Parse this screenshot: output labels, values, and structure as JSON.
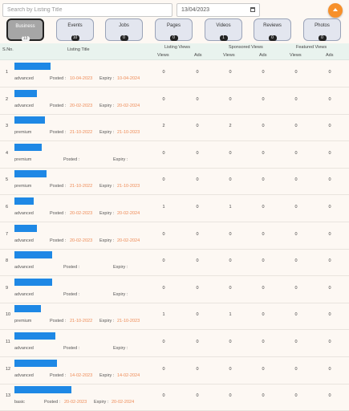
{
  "search": {
    "placeholder": "Search by Listing Title",
    "value": ""
  },
  "date_filter": {
    "value": "13/04/2023"
  },
  "fab": {
    "icon": "chevron-up-icon",
    "color": "#f7902a"
  },
  "tabs": [
    {
      "label": "Business",
      "count": "13",
      "active": true
    },
    {
      "label": "Events",
      "count": "10",
      "active": false
    },
    {
      "label": "Jobs",
      "count": "0",
      "active": false
    },
    {
      "label": "Pages",
      "count": "0",
      "active": false
    },
    {
      "label": "Videos",
      "count": "1",
      "active": false
    },
    {
      "label": "Reviews",
      "count": "0",
      "active": false
    },
    {
      "label": "Photos",
      "count": "0",
      "active": false
    }
  ],
  "table": {
    "headers": {
      "sno": "S.No.",
      "title": "Listing Title",
      "listing_views": "Listing Views",
      "sponsored_views": "Sponsored Views",
      "featured_views": "Featured Views",
      "views": "Views",
      "ads": "Ads"
    },
    "posted_label": "Posted :",
    "expiry_label": "Expiry :",
    "title_bar_color": "#1e88e5",
    "rows": [
      {
        "sno": "1",
        "type": "advanced",
        "posted": "10-04-2023",
        "expiry": "10-04-2024",
        "lv": "0",
        "la": "0",
        "sv": "0",
        "sa": "0",
        "fv": "0",
        "fa": "0"
      },
      {
        "sno": "2",
        "type": "advanced",
        "posted": "20-02-2023",
        "expiry": "20-02-2024",
        "lv": "0",
        "la": "0",
        "sv": "0",
        "sa": "0",
        "fv": "0",
        "fa": "0"
      },
      {
        "sno": "3",
        "type": "premium",
        "posted": "21-10-2022",
        "expiry": "21-10-2023",
        "lv": "2",
        "la": "0",
        "sv": "2",
        "sa": "0",
        "fv": "0",
        "fa": "0"
      },
      {
        "sno": "4",
        "type": "premium",
        "posted": "",
        "expiry": "",
        "lv": "0",
        "la": "0",
        "sv": "0",
        "sa": "0",
        "fv": "0",
        "fa": "0"
      },
      {
        "sno": "5",
        "type": "premium",
        "posted": "21-10-2022",
        "expiry": "21-10-2023",
        "lv": "0",
        "la": "0",
        "sv": "0",
        "sa": "0",
        "fv": "0",
        "fa": "0"
      },
      {
        "sno": "6",
        "type": "advanced",
        "posted": "20-02-2023",
        "expiry": "20-02-2024",
        "lv": "1",
        "la": "0",
        "sv": "1",
        "sa": "0",
        "fv": "0",
        "fa": "0"
      },
      {
        "sno": "7",
        "type": "advanced",
        "posted": "20-02-2023",
        "expiry": "20-02-2024",
        "lv": "0",
        "la": "0",
        "sv": "0",
        "sa": "0",
        "fv": "0",
        "fa": "0"
      },
      {
        "sno": "8",
        "type": "advanced",
        "posted": "",
        "expiry": "",
        "lv": "0",
        "la": "0",
        "sv": "0",
        "sa": "0",
        "fv": "0",
        "fa": "0"
      },
      {
        "sno": "9",
        "type": "advanced",
        "posted": "",
        "expiry": "",
        "lv": "0",
        "la": "0",
        "sv": "0",
        "sa": "0",
        "fv": "0",
        "fa": "0"
      },
      {
        "sno": "10",
        "type": "premium",
        "posted": "21-10-2022",
        "expiry": "21-10-2023",
        "lv": "1",
        "la": "0",
        "sv": "1",
        "sa": "0",
        "fv": "0",
        "fa": "0"
      },
      {
        "sno": "11",
        "type": "advanced",
        "posted": "",
        "expiry": "",
        "lv": "0",
        "la": "0",
        "sv": "0",
        "sa": "0",
        "fv": "0",
        "fa": "0"
      },
      {
        "sno": "12",
        "type": "advanced",
        "posted": "14-02-2023",
        "expiry": "14-02-2024",
        "lv": "0",
        "la": "0",
        "sv": "0",
        "sa": "0",
        "fv": "0",
        "fa": "0"
      },
      {
        "sno": "13",
        "type": "basic",
        "posted": "20-02-2023",
        "expiry": "20-02-2024",
        "lv": "0",
        "la": "0",
        "sv": "0",
        "sa": "0",
        "fv": "0",
        "fa": "0"
      }
    ]
  }
}
